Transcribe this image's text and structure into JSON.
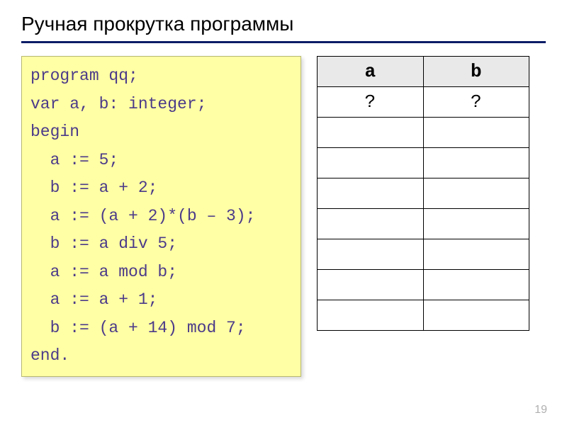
{
  "title": "Ручная прокрутка программы",
  "code": {
    "lines": [
      "program qq;",
      "var a, b: integer;",
      "begin",
      "  a := 5;",
      "  b := a + 2;",
      "  a := (a + 2)*(b – 3);",
      "  b := a div 5;",
      "  a := a mod b;",
      "  a := a + 1;",
      "  b := (a + 14) mod 7;",
      "end."
    ]
  },
  "table": {
    "headers": [
      "a",
      "b"
    ],
    "rows": [
      [
        "?",
        "?"
      ],
      [
        "",
        ""
      ],
      [
        "",
        ""
      ],
      [
        "",
        ""
      ],
      [
        "",
        ""
      ],
      [
        "",
        ""
      ],
      [
        "",
        ""
      ],
      [
        "",
        ""
      ]
    ]
  },
  "page_number": "19"
}
